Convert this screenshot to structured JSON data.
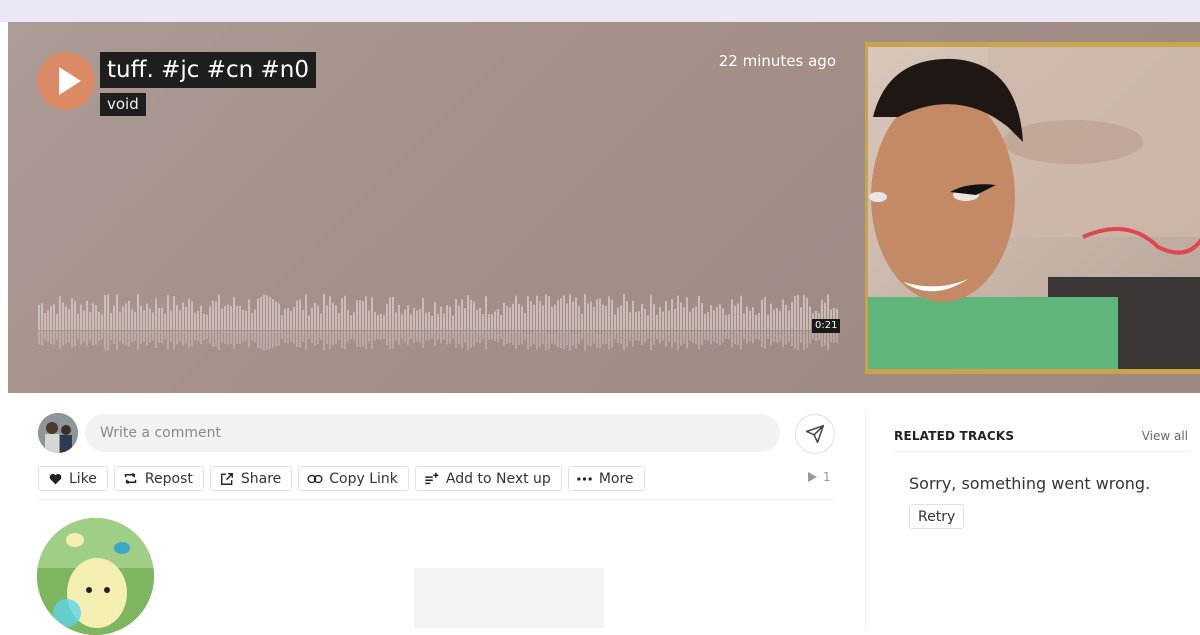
{
  "track": {
    "title": "tuff. #jc #cn #n0",
    "artist": "void",
    "posted": "22 minutes ago",
    "duration": "0:21",
    "plays": "1"
  },
  "comment": {
    "placeholder": "Write a comment"
  },
  "actions": {
    "like": "Like",
    "repost": "Repost",
    "share": "Share",
    "copy_link": "Copy Link",
    "add_to_next_up": "Add to Next up",
    "more": "More"
  },
  "related": {
    "title": "RELATED TRACKS",
    "view_all": "View all",
    "error": "Sorry, something went wrong.",
    "retry": "Retry"
  },
  "colors": {
    "accent": "#dc8a66",
    "hero_bg": "#a59189",
    "frame": "#c9a44a",
    "top_strip": "#ece6f6"
  }
}
